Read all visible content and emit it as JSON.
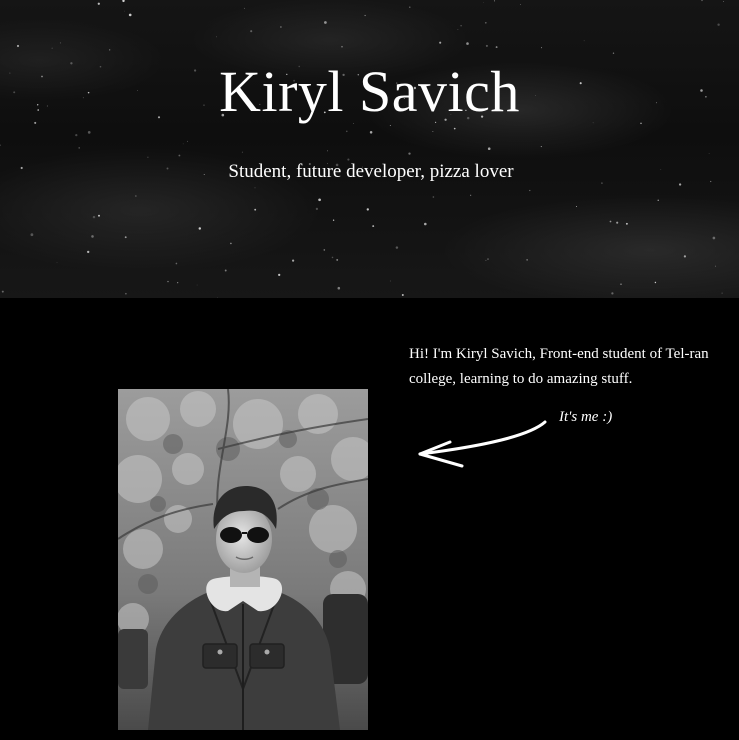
{
  "hero": {
    "title": "Kiryl Savich",
    "subtitle": "Student, future developer, pizza lover"
  },
  "about": {
    "intro": "Hi! I'm Kiryl Savich, Front-end student of Tel-ran college, learning to do amazing stuff.",
    "arrow_label": "It's me :)",
    "photo_icon": "profile-photo"
  },
  "colors": {
    "background": "#000000",
    "text": "#ffffff"
  }
}
